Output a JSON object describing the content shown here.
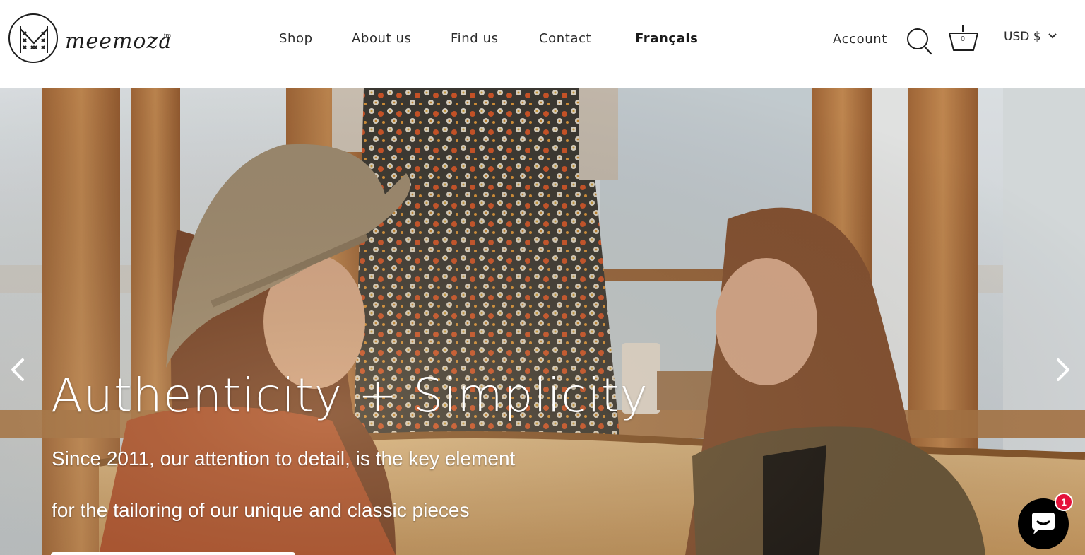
{
  "brand": {
    "name": "meemoza",
    "tm": "tm"
  },
  "nav": {
    "items": [
      {
        "label": "Shop"
      },
      {
        "label": "About us"
      },
      {
        "label": "Find us"
      },
      {
        "label": "Contact"
      },
      {
        "label": "Français"
      }
    ]
  },
  "header": {
    "account_label": "Account",
    "cart_count": "0",
    "currency": "USD $"
  },
  "hero": {
    "title": "Authenticity + Simplicity",
    "line1": "Since 2011, our attention to detail, is the key element",
    "line2": "for the tailoring of our unique and classic pieces"
  },
  "chat": {
    "badge": "1"
  },
  "colors": {
    "text": "#2b2b2b",
    "hero_text": "#ffffff",
    "chat_bubble": "#000000",
    "badge": "#e5123b"
  },
  "icons": [
    "search-icon",
    "cart-icon",
    "chevron-down-icon",
    "chevron-left-icon",
    "chevron-right-icon",
    "chat-icon"
  ]
}
